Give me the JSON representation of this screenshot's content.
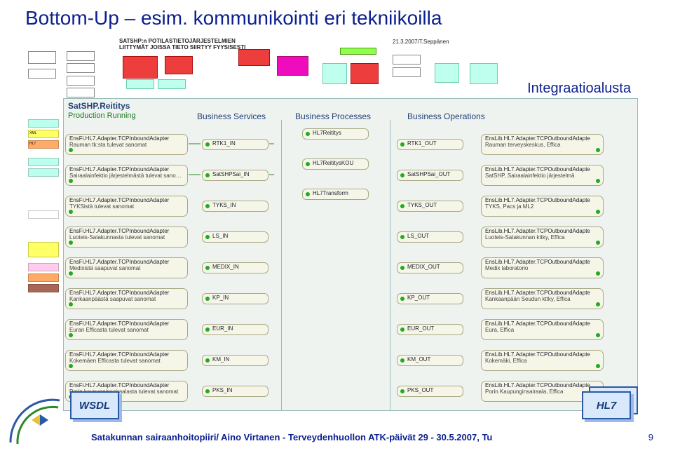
{
  "title": "Bottom-Up – esim. kommunikointi eri tekniikoilla",
  "subheader_line1": "SATSHP:n POTILASTIETOJÄRJESTELMIEN",
  "subheader_line2": "LIITTYMÄT JOISSA TIETO SIIRTYY FYYSISESTI",
  "subheader_right": "21.3.2007/T.Seppänen",
  "integ_label": "Integraatioalusta",
  "panel": {
    "title": "SatSHP.Reititys",
    "status": "Production Running",
    "columns": {
      "services": "Business Services",
      "processes": "Business Processes",
      "operations": "Business Operations"
    }
  },
  "left_adapters": [
    {
      "t": "EnsFi.HL7.Adapter.TCPInboundAdapter",
      "s": "Rauman tk:sta tulevat sanomat"
    },
    {
      "t": "EnsFi.HL7.Adapter.TCPInboundAdapter",
      "s": "Sairaalainfektio järjestelmästä tulevat sanomat"
    },
    {
      "t": "EnsFi.HL7.Adapter.TCPInboundAdapter",
      "s": "TYKSistä tulevat sanomat"
    },
    {
      "t": "EnsFi.HL7.Adapter.TCPInboundAdapter",
      "s": "Luoteis-Satakunnasta tulevat sanomat"
    },
    {
      "t": "EnsFi.HL7.Adapter.TCPInboundAdapter",
      "s": "Medixistä saapuvat sanomat"
    },
    {
      "t": "EnsFi.HL7.Adapter.TCPInboundAdapter",
      "s": "Kankaanpäästä saapuvat sanomat"
    },
    {
      "t": "EnsFi.HL7.Adapter.TCPInboundAdapter",
      "s": "Euran Efficasta tulevat sanomat"
    },
    {
      "t": "EnsFi.HL7.Adapter.TCPInboundAdapter",
      "s": "Kokemäen Efficasta tulevat sanomat"
    },
    {
      "t": "EnsFi.HL7.Adapter.TCPInboundAdapter",
      "s": "Porin kaupunginsairaalasta tulevat sanomat"
    }
  ],
  "in_nodes": [
    "RTK1_IN",
    "SatSHPSai_IN",
    "TYKS_IN",
    "LS_IN",
    "MEDIX_IN",
    "KP_IN",
    "EUR_IN",
    "KM_IN",
    "PKS_IN"
  ],
  "process_nodes": [
    "HL7Reititys",
    "HL7ReititysKOU",
    "HL7Transform"
  ],
  "out_nodes": [
    "RTK1_OUT",
    "SatSHPSai_OUT",
    "TYKS_OUT",
    "LS_OUT",
    "MEDIX_OUT",
    "KP_OUT",
    "EUR_OUT",
    "KM_OUT",
    "PKS_OUT"
  ],
  "right_adapters": [
    {
      "t": "EnsLib.HL7.Adapter.TCPOutboundAdapte",
      "s": "Rauman terveyskeskus, Effica"
    },
    {
      "t": "EnsLib.HL7.Adapter.TCPOutboundAdapte",
      "s": "SatSHP, Sairaalainfektio järjestelmä"
    },
    {
      "t": "EnsLib.HL7.Adapter.TCPOutboundAdapte",
      "s": "TYKS, Pacs ja ML2"
    },
    {
      "t": "EnsLib.HL7.Adapter.TCPOutboundAdapte",
      "s": "Luoteis-Satakunnan kttky, Effica"
    },
    {
      "t": "EnsLib.HL7.Adapter.TCPOutboundAdapte",
      "s": "Medix laboratorio"
    },
    {
      "t": "EnsLib.HL7.Adapter.TCPOutboundAdapte",
      "s": "Kankaanpään Seudun kttky, Effica"
    },
    {
      "t": "EnsLib.HL7.Adapter.TCPOutboundAdapte",
      "s": "Eura, Effica"
    },
    {
      "t": "EnsLib.HL7.Adapter.TCPOutboundAdapte",
      "s": "Kokemäki, Effica"
    },
    {
      "t": "EnsLib.HL7.Adapter.TCPOutboundAdapte",
      "s": "Porin Kaupunginsairaala, Effica"
    }
  ],
  "left_strips": [
    {
      "label": "XML"
    },
    {
      "label": "HL7"
    },
    {
      "label": ""
    }
  ],
  "badges": {
    "wsdl": "WSDL",
    "hl7": "HL7",
    "hl7b": "HL7"
  },
  "footer": "Satakunnan sairaanhoitopiiri/ Aino Virtanen - Terveydenhuollon ATK-päivät  29 - 30.5.2007, Tu",
  "pagenum": "9"
}
